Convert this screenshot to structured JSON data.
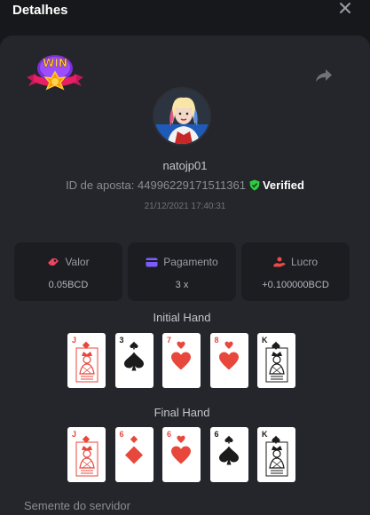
{
  "header": {
    "title": "Detalhes",
    "close_icon": "close-icon"
  },
  "player": {
    "username": "natojp01",
    "bet_id_label": "ID de aposta:",
    "bet_id": "44996229171511361",
    "verified": "Verified",
    "datetime": "21/12/2021 17:40:31",
    "badge": "WIN"
  },
  "stats": [
    {
      "label": "Valor",
      "value": "0.05BCD",
      "icon": "bet-chips-icon",
      "color": "#e94560"
    },
    {
      "label": "Pagamento",
      "value": "3 x",
      "icon": "card-icon",
      "color": "#7c5cff"
    },
    {
      "label": "Lucro",
      "value": "+0.100000BCD",
      "icon": "profit-hand-icon",
      "color": "#e94a4a"
    }
  ],
  "initial_hand": {
    "label": "Initial Hand",
    "cards": [
      {
        "rank": "J",
        "suit": "diamonds",
        "color": "red"
      },
      {
        "rank": "3",
        "suit": "spades",
        "color": "black"
      },
      {
        "rank": "7",
        "suit": "hearts",
        "color": "red"
      },
      {
        "rank": "8",
        "suit": "hearts",
        "color": "red"
      },
      {
        "rank": "K",
        "suit": "spades",
        "color": "black"
      }
    ]
  },
  "final_hand": {
    "label": "Final Hand",
    "cards": [
      {
        "rank": "J",
        "suit": "diamonds",
        "color": "red"
      },
      {
        "rank": "6",
        "suit": "diamonds",
        "color": "red"
      },
      {
        "rank": "6",
        "suit": "hearts",
        "color": "red"
      },
      {
        "rank": "6",
        "suit": "spades",
        "color": "black"
      },
      {
        "rank": "K",
        "suit": "spades",
        "color": "black"
      }
    ]
  },
  "server_seed_label": "Semente do servidor",
  "colors": {
    "background": "#17181b",
    "panel": "#24262b",
    "stat_bg": "#1c1d21",
    "verified_green": "#2ecc40"
  }
}
